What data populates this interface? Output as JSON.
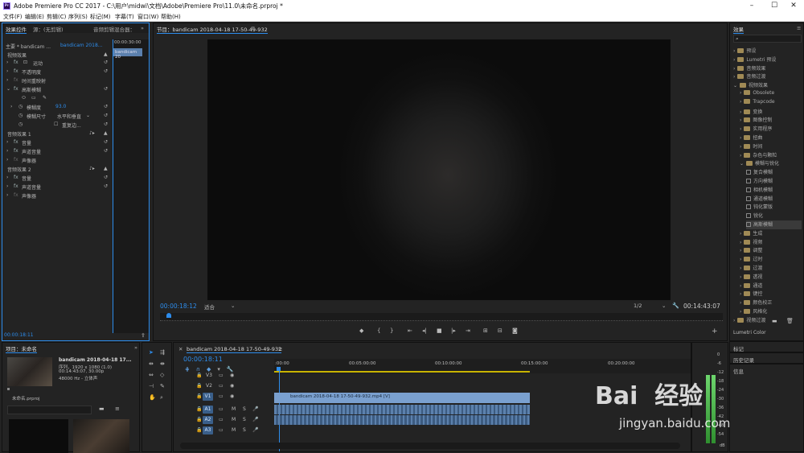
{
  "titlebar": {
    "app": "Adobe Premiere Pro CC 2017 - C:\\用户\\midwi\\文档\\Adobe\\Premiere Pro\\11.0\\未命名.prproj *",
    "logo": "Pr"
  },
  "menu": [
    "文件(F)",
    "编辑(E)",
    "剪辑(C)",
    "序列(S)",
    "标记(M)",
    "字幕(T)",
    "窗口(W)",
    "帮助(H)"
  ],
  "effect_controls": {
    "tabs": [
      "效果控件",
      "源：(无剪辑)",
      "音频剪辑混合器："
    ],
    "master": "主要 * bandicam ...",
    "clip": "bandicam 2018...",
    "ruler_time": "00:00:30:00",
    "clip_bar": "bandicam 20",
    "video_fx": "视频效果",
    "motion": "运动",
    "opacity": "不透明度",
    "time_remap": "时间重映射",
    "gaussian": "高斯模糊",
    "blurriness": "模糊度",
    "blurriness_val": "93.0",
    "dimension": "模糊尺寸",
    "dimension_val": "水平和垂直",
    "repeat": "重复边...",
    "audio_fx1": "音频效果 1",
    "audio_fx2": "音频效果 2",
    "volume": "音量",
    "channel_vol": "声道音量",
    "panner": "声像器",
    "timecode": "00:00:18:11",
    "fx": "fx"
  },
  "program": {
    "title": "节目：bandicam 2018-04-18 17-50-49-932",
    "timecode": "00:00:18:12",
    "fit": "适合",
    "quality": "1/2",
    "duration": "00:14:43:07"
  },
  "project": {
    "title": "项目：未命名",
    "clip_name": "bandicam 2018-04-18 17...",
    "seq": "序列，1920 x 1080 (1.0)",
    "dur": "00:14:43:07, 30.00p",
    "audio": "48000 Hz - 立体声",
    "file": "未命名.prproj"
  },
  "timeline": {
    "tab": "bandicam 2018-04-18 17-50-49-932",
    "timecode": "00:00:18:11",
    "ruler": [
      ":00:00",
      "00:05:00:00",
      "00:10:00:00",
      "00:15:00:00",
      "00:20:00:00"
    ],
    "tracks": [
      "V3",
      "V2",
      "V1",
      "A1",
      "A2",
      "A3"
    ],
    "clip": "bandicam 2018-04-18 17-50-49-932.mp4 [V]",
    "m": "M",
    "s": "S"
  },
  "effects": {
    "title": "效果",
    "items": [
      "预设",
      "Lumetri 预设",
      "音频效果",
      "音频过渡",
      "视频效果",
      "Obsolete",
      "Trapcode",
      "变换",
      "图像控制",
      "实用程序",
      "扭曲",
      "时间",
      "杂色与颗粒",
      "模糊与锐化",
      "复合模糊",
      "方向模糊",
      "相机模糊",
      "通道模糊",
      "钝化蒙版",
      "锐化",
      "高斯模糊",
      "生成",
      "视频",
      "调整",
      "过时",
      "过渡",
      "透视",
      "通道",
      "键控",
      "颜色校正",
      "风格化",
      "视频过渡"
    ],
    "side_panels": [
      "Lumetri Color",
      "标记",
      "历史记录",
      "信息"
    ]
  },
  "meter": {
    "labels": [
      "0",
      "-6",
      "-12",
      "-18",
      "-24",
      "-30",
      "-36",
      "-42",
      "-48",
      "-54"
    ],
    "unit": "dB"
  },
  "watermark": {
    "text": "Bai  经验",
    "url": "jingyan.baidu.com"
  }
}
